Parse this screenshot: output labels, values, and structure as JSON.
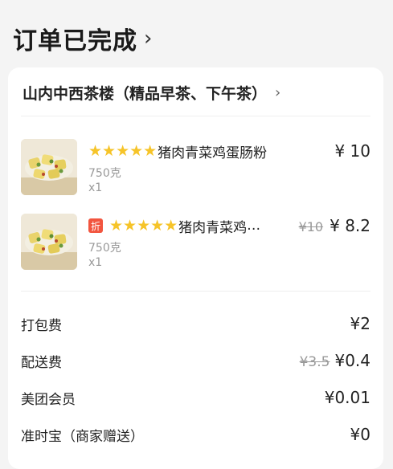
{
  "header": {
    "title": "订单已完成",
    "chevron": "›"
  },
  "shop": {
    "name": "山内中西茶楼（精品早茶、下午茶）",
    "chevron": "›"
  },
  "items": [
    {
      "stars": "★★★★★",
      "name": "猪肉青菜鸡蛋肠粉",
      "spec": "750克",
      "qty": "x1",
      "price": "¥ 10"
    },
    {
      "badge": "折",
      "stars": "★★★★★",
      "name": "猪肉青菜鸡",
      "ellipsis": "…",
      "orig_price": "¥10",
      "price": "¥ 8.2",
      "spec": "750克",
      "qty": "x1"
    }
  ],
  "fees": [
    {
      "label": "打包费",
      "amount": "¥2"
    },
    {
      "label": "配送费",
      "orig": "¥3.5",
      "amount": "¥0.4"
    },
    {
      "label": "美团会员",
      "amount": "¥0.01"
    },
    {
      "label": "准时宝（商家赠送）",
      "amount": "¥0"
    }
  ],
  "colors": {
    "star": "#f6c429",
    "badge": "#f2553f",
    "strike": "#999999"
  }
}
